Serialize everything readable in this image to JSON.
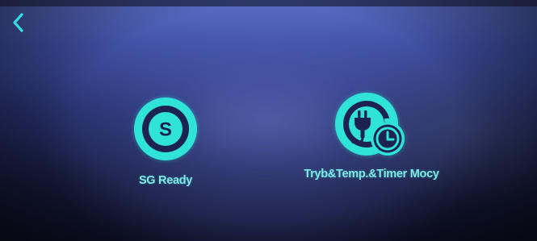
{
  "screen": {
    "back_icon": "chevron-left-icon",
    "accent_color": "#2fe3d8",
    "background_color": "#1a2050"
  },
  "tiles": [
    {
      "label": "SG Ready",
      "icon": "sg-ready-icon"
    },
    {
      "label": "Tryb&Temp.&Timer Mocy",
      "icon": "power-plug-timer-icon"
    }
  ]
}
